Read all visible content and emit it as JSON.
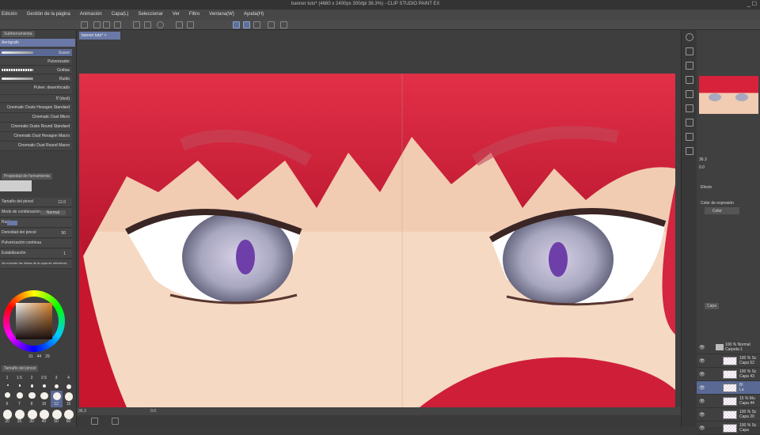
{
  "title": "banner tuto* (4680 x 2400px 300dpi 36.3%) - CLIP STUDIO PAINT EX",
  "menu": [
    "Edición",
    "Gestión de la página",
    "Animación",
    "Capa(L)",
    "Seleccionar",
    "Ver",
    "Filtro",
    "Ventana(W)",
    "Ayuda(H)"
  ],
  "left_panel": {
    "subtool_tab": "Subherramienta",
    "group": "Aerógrafo",
    "brushes": [
      "Suave",
      "Pulverizador",
      "Gotitas",
      "Ruido",
      "Pulver. desenfocado",
      "5\"(dust)",
      "Cinematic Dusts Hexagon Standard",
      "Cinematic Dust Micro",
      "Cinematic Dusts Round Standard",
      "Cinematic Dust Hexagon Macro",
      "Cinematic Dust Round Macro"
    ],
    "tool_property_tab": "Propiedad de herramienta",
    "properties": [
      {
        "label": "Tamaño del pincel",
        "value": "12.0"
      },
      {
        "label": "Modo de combinación",
        "value": "Normal"
      },
      {
        "label": "Ruido",
        "value": ""
      },
      {
        "label": "Densidad del pincel",
        "value": "50"
      },
      {
        "label": "Pulverización continua",
        "value": ""
      },
      {
        "label": "Estabilización",
        "value": "1"
      },
      {
        "label": "No exceder las líneas de la capa de referencia",
        "value": ""
      }
    ],
    "color_values": [
      "31",
      "44",
      "29"
    ],
    "brush_size_tab": "Tamaño del pincel",
    "brush_sizes": [
      "1",
      "1.5",
      "2",
      "2.5",
      "3",
      "4",
      "6",
      "7",
      "8",
      "10",
      "12",
      "15",
      "20",
      "25",
      "30",
      "40",
      "50",
      "60"
    ],
    "selected_size": "12"
  },
  "canvas": {
    "doc_tab": "banner tuto*",
    "zoom": "36.3",
    "angle": "0.0"
  },
  "right_panel": {
    "nav_zoom": "36.3",
    "nav_angle": "0.0",
    "effect_label": "Efecto",
    "expression_label": "Color de expresión",
    "expression_value": "Color",
    "layer_tab": "Capa",
    "layers": [
      {
        "opacity": "100 % Normal",
        "name": "Carpeta 1",
        "folder": true
      },
      {
        "opacity": "100 % Sc",
        "name": "Capa 52"
      },
      {
        "opacity": "100 % Sc",
        "name": "Capa 43"
      },
      {
        "opacity": "Bl",
        "name": "La",
        "selected": true
      },
      {
        "opacity": "15 % Mu",
        "name": "Capa 44"
      },
      {
        "opacity": "100 % Sc",
        "name": "Capa 20"
      },
      {
        "opacity": "100 % Sc",
        "name": "Capa"
      }
    ]
  },
  "colors": {
    "accent": "#6a79a8",
    "hair": "#d8223c",
    "skin": "#f3d2b8",
    "iris": "#b9b4cc"
  }
}
